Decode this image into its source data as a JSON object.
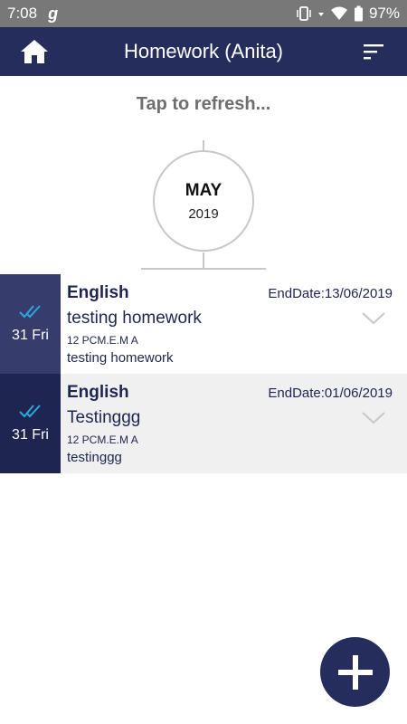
{
  "status_bar": {
    "time": "7:08",
    "app_glyph": "g",
    "battery": "97%",
    "icons": [
      "vibrate-icon",
      "wifi-icon",
      "battery-icon"
    ]
  },
  "app_bar": {
    "title": "Homework (Anita)",
    "left_icon": "home-icon",
    "right_icon": "sort-icon"
  },
  "refresh_text": "Tap to refresh...",
  "month_marker": {
    "month": "MAY",
    "year": "2019"
  },
  "homework": [
    {
      "day": "31 Fri",
      "subject": "English",
      "end_date": "EndDate:13/06/2019",
      "title": "testing homework",
      "class": "12 PCM.E.M A",
      "description": "testing homework",
      "date_color": "#363d6c",
      "row_color": "#ffffff"
    },
    {
      "day": "31 Fri",
      "subject": "English",
      "end_date": "EndDate:01/06/2019",
      "title": "Testinggg",
      "class": "12 PCM.E.M A",
      "description": "testinggg",
      "date_color": "#1d2550",
      "row_color": "#f0f0f0"
    }
  ],
  "fab_icon": "plus-icon",
  "colors": {
    "primary": "#252d5c",
    "status_bar": "#787878",
    "check": "#29a8e0"
  }
}
